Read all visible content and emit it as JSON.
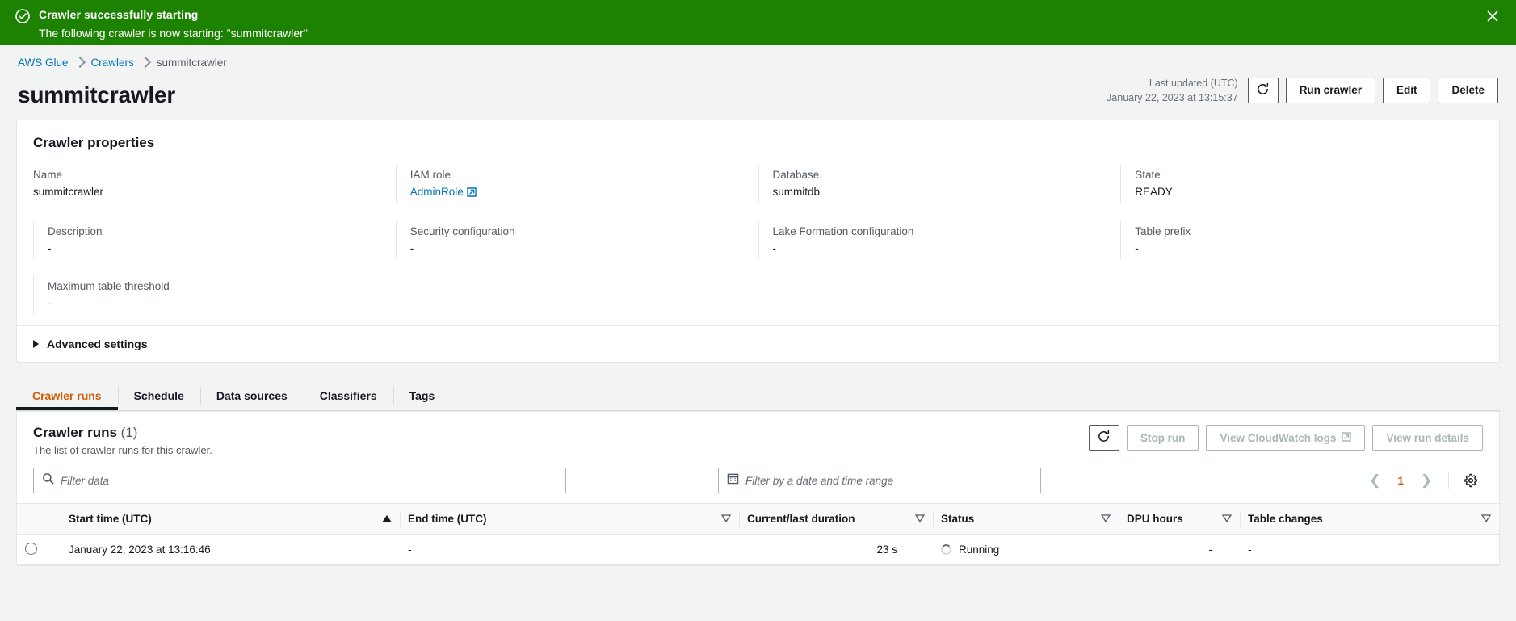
{
  "flash": {
    "icon": "check-circle-icon",
    "title": "Crawler successfully starting",
    "message": "The following crawler is now starting: \"summitcrawler\"",
    "close_label": "×",
    "background": "#1d8102"
  },
  "breadcrumb": {
    "items": [
      {
        "label": "AWS Glue",
        "link": true
      },
      {
        "label": "Crawlers",
        "link": true
      },
      {
        "label": "summitcrawler",
        "link": false
      }
    ]
  },
  "header": {
    "title": "summitcrawler",
    "last_updated_label": "Last updated (UTC)",
    "last_updated_value": "January 22, 2023 at 13:15:37",
    "refresh_icon": "refresh-icon",
    "buttons": [
      {
        "label": "Run crawler"
      },
      {
        "label": "Edit"
      },
      {
        "label": "Delete"
      }
    ]
  },
  "properties": {
    "title": "Crawler properties",
    "fields": [
      {
        "label": "Name",
        "value": "summitcrawler",
        "type": "text"
      },
      {
        "label": "IAM role",
        "value": "AdminRole",
        "type": "link"
      },
      {
        "label": "Database",
        "value": "summitdb",
        "type": "text"
      },
      {
        "label": "State",
        "value": "READY",
        "type": "text"
      },
      {
        "label": "Description",
        "value": "-",
        "type": "text"
      },
      {
        "label": "Security configuration",
        "value": "-",
        "type": "text"
      },
      {
        "label": "Lake Formation configuration",
        "value": "-",
        "type": "text"
      },
      {
        "label": "Table prefix",
        "value": "-",
        "type": "text"
      },
      {
        "label": "Maximum table threshold",
        "value": "-",
        "type": "text"
      }
    ],
    "advanced_settings_label": "Advanced settings",
    "advanced_expanded": false
  },
  "tabs": {
    "items": [
      {
        "label": "Crawler runs",
        "active": true
      },
      {
        "label": "Schedule",
        "active": false
      },
      {
        "label": "Data sources",
        "active": false
      },
      {
        "label": "Classifiers",
        "active": false
      },
      {
        "label": "Tags",
        "active": false
      }
    ]
  },
  "runs": {
    "title": "Crawler runs",
    "count": "(1)",
    "subtitle": "The list of crawler runs for this crawler.",
    "refresh_icon": "refresh-icon",
    "actions": [
      {
        "label": "Stop run",
        "disabled": true
      },
      {
        "label": "View CloudWatch logs",
        "disabled": true,
        "external": true
      },
      {
        "label": "View run details",
        "disabled": true
      }
    ],
    "search": {
      "icon": "search-icon",
      "placeholder": "Filter data",
      "value": ""
    },
    "date_filter": {
      "icon": "calendar-icon",
      "placeholder": "Filter by a date and time range",
      "value": ""
    },
    "pagination": {
      "prev_icon": "chevron-left-icon",
      "page": "1",
      "next_icon": "chevron-right-icon",
      "settings_icon": "gear-icon"
    },
    "table": {
      "columns": [
        {
          "label": "Start time (UTC)",
          "sort": "asc"
        },
        {
          "label": "End time (UTC)",
          "sort": "none"
        },
        {
          "label": "Current/last duration",
          "sort": "none"
        },
        {
          "label": "Status",
          "sort": "none"
        },
        {
          "label": "DPU hours",
          "sort": "none"
        },
        {
          "label": "Table changes",
          "sort": "none"
        }
      ],
      "rows": [
        {
          "selected": false,
          "start_time": "January 22, 2023 at 13:16:46",
          "end_time": "-",
          "duration": "23 s",
          "status": "Running",
          "dpu_hours": "-",
          "table_changes": "-"
        }
      ]
    }
  }
}
